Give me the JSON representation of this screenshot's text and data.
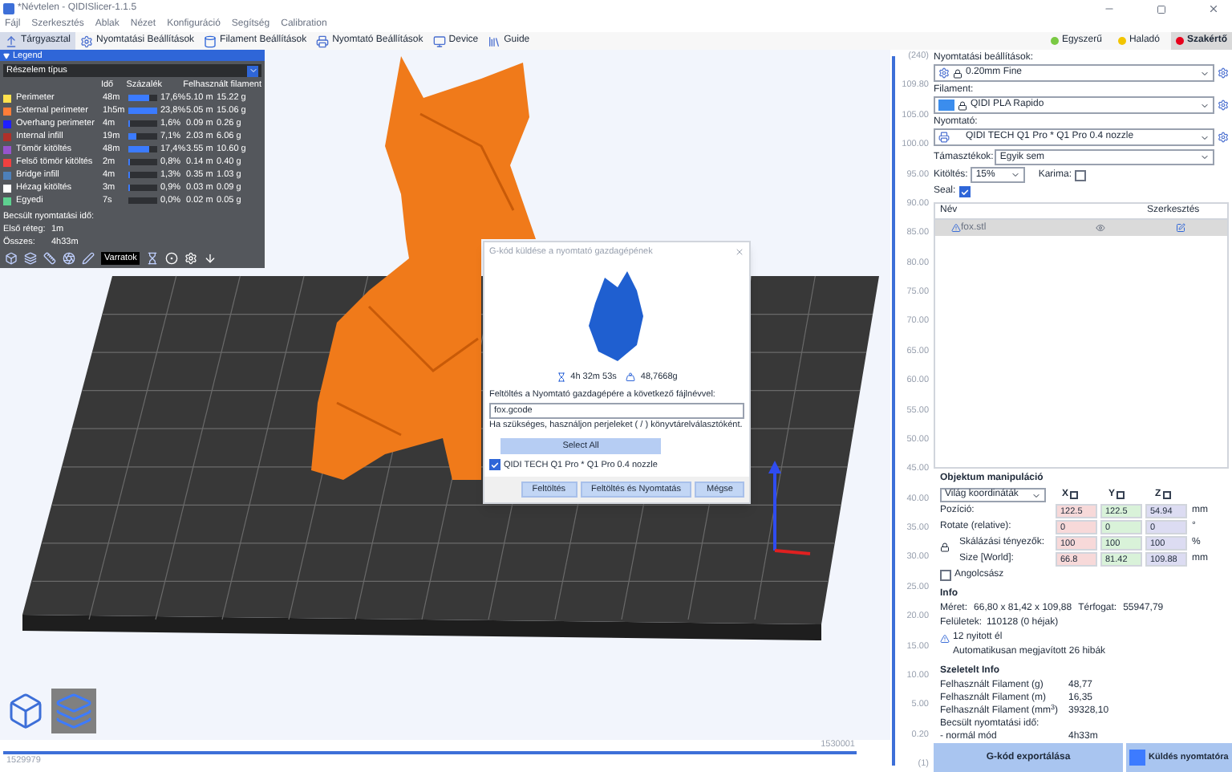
{
  "window": {
    "title": "*Névtelen - QIDISlicer-1.1.5"
  },
  "menu": [
    "Fájl",
    "Szerkesztés",
    "Ablak",
    "Nézet",
    "Konfiguráció",
    "Segítség",
    "Calibration"
  ],
  "tabs": [
    {
      "label": "Tárgyasztal",
      "kind": "plate",
      "selected": true
    },
    {
      "label": "Nyomtatási Beállítások",
      "kind": "print",
      "selected": false
    },
    {
      "label": "Filament Beállítások",
      "kind": "filament",
      "selected": false
    },
    {
      "label": "Nyomtató Beállítások",
      "kind": "printer",
      "selected": false
    },
    {
      "label": "Device",
      "kind": "device",
      "selected": false
    },
    {
      "label": "Guide",
      "kind": "guide",
      "selected": false
    }
  ],
  "modes": [
    {
      "label": "Egyszerű",
      "color": "#7ac943",
      "selected": false
    },
    {
      "label": "Haladó",
      "color": "#f2c500",
      "selected": false
    },
    {
      "label": "Szakértő",
      "color": "#e8001c",
      "selected": true
    }
  ],
  "legend": {
    "title": "Legend",
    "view_type": "Részelem típus",
    "columns": [
      "Idő",
      "Százalék",
      "Felhasznált filament"
    ],
    "rows": [
      {
        "name": "Perimeter",
        "color": "#ffe14d",
        "time": "48m",
        "level": 0.74,
        "percent": "17,6%",
        "length": "5.10 m",
        "weight": "15.22 g"
      },
      {
        "name": "External perimeter",
        "color": "#ff7d38",
        "time": "1h5m",
        "level": 1.0,
        "percent": "23,8%",
        "length": "5.05 m",
        "weight": "15.06 g"
      },
      {
        "name": "Overhang perimeter",
        "color": "#1f1fff",
        "time": "4m",
        "level": 0.07,
        "percent": "1,6%",
        "length": "0.09 m",
        "weight": "0.26 g"
      },
      {
        "name": "Internal infill",
        "color": "#b03029",
        "time": "19m",
        "level": 0.3,
        "percent": "7,1%",
        "length": "2.03 m",
        "weight": "6.06 g"
      },
      {
        "name": "Tömör kitöltés",
        "color": "#9654cc",
        "time": "48m",
        "level": 0.73,
        "percent": "17,4%",
        "length": "3.55 m",
        "weight": "10.60 g"
      },
      {
        "name": "Felső tömör kitöltés",
        "color": "#f04040",
        "time": "2m",
        "level": 0.03,
        "percent": "0,8%",
        "length": "0.14 m",
        "weight": "0.40 g"
      },
      {
        "name": "Bridge infill",
        "color": "#4d80ba",
        "time": "4m",
        "level": 0.05,
        "percent": "1,3%",
        "length": "0.35 m",
        "weight": "1.03 g"
      },
      {
        "name": "Hézag kitöltés",
        "color": "#ffffff",
        "time": "3m",
        "level": 0.04,
        "percent": "0,9%",
        "length": "0.03 m",
        "weight": "0.09 g"
      },
      {
        "name": "Egyedi",
        "color": "#5ed190",
        "time": "7s",
        "level": 0.0,
        "percent": "0,0%",
        "length": "0.02 m",
        "weight": "0.05 g"
      }
    ],
    "estimate_title": "Becsült nyomtatási idő:",
    "estimates": [
      {
        "label": "Első réteg:",
        "value": "1m"
      },
      {
        "label": "Összes:",
        "value": "4h33m"
      }
    ],
    "tooltip": "Varratok"
  },
  "dialog": {
    "title": "G-kód küldése a nyomtató gazdagépének",
    "time": "4h 32m 53s",
    "weight": "48,7668g",
    "prompt": "Feltöltés a Nyomtató gazdagépére a következő fájlnévvel:",
    "filename": "fox.gcode",
    "hint": "Ha szükséges, használjon perjeleket ( / ) könyvtárelválasztóként.",
    "select_all": "Select All",
    "printer": {
      "label": "QIDI TECH Q1 Pro * Q1 Pro 0.4 nozzle",
      "checked": true
    },
    "buttons": [
      "Feltöltés",
      "Feltöltés és Nyomtatás",
      "Mégse"
    ]
  },
  "view_buttons": [
    {
      "kind": "perspective",
      "selected": false
    },
    {
      "kind": "preview",
      "selected": true
    }
  ],
  "move_slider": {
    "level": 1.0,
    "left_value": "1529979",
    "right_value": "1530001"
  },
  "layer_slider": {
    "level": 1.0,
    "top_label": "(240)",
    "top_value": "109.80",
    "ticks": [
      "105.00",
      "100.00",
      "95.00",
      "90.00",
      "85.00",
      "80.00",
      "75.00",
      "70.00",
      "65.00",
      "60.00",
      "55.00",
      "50.00",
      "45.00",
      "40.00",
      "35.00",
      "30.00",
      "25.00",
      "20.00",
      "15.00",
      "10.00",
      "5.00"
    ],
    "bottom_value": "0.20",
    "bottom_label": "(1)"
  },
  "presets": [
    {
      "label": "Nyomtatási beállítások:",
      "kind": "print",
      "locked": true,
      "value": "0.20mm Fine"
    },
    {
      "label": "Filament:",
      "kind": "filament",
      "color": "#3b8ded",
      "locked": true,
      "value": "QIDI PLA Rapido"
    },
    {
      "label": "Nyomtató:",
      "kind": "printer",
      "locked": false,
      "value": "QIDI TECH Q1 Pro * Q1 Pro 0.4 nozzle"
    }
  ],
  "supports": {
    "label": "Támasztékok:",
    "value": "Egyik sem"
  },
  "infill": {
    "label": "Kitöltés:",
    "value": "15%"
  },
  "brim": {
    "label": "Karima:",
    "checked": false
  },
  "seal": {
    "label": "Seal:",
    "checked": true
  },
  "object_list": {
    "columns": [
      "Név",
      "Szerkesztés"
    ],
    "rows": [
      {
        "name": "fox.stl",
        "warning": true,
        "selected": true
      }
    ]
  },
  "manipulation": {
    "title": "Objektum manipuláció",
    "coordinates": "Világ koordináták",
    "axes": [
      "X",
      "Y",
      "Z"
    ],
    "rows": [
      {
        "label": "Pozíció:",
        "values": [
          "122.5",
          "122.5",
          "54.94"
        ],
        "unit": "mm"
      },
      {
        "label": "Rotate (relative):",
        "values": [
          "0",
          "0",
          "0"
        ],
        "unit": "°"
      },
      {
        "label": "Skálázási tényezők:",
        "values": [
          "100",
          "100",
          "100"
        ],
        "unit": "%"
      },
      {
        "label": "Size [World]:",
        "values": [
          "66.8",
          "81.42",
          "109.88"
        ],
        "unit": "mm"
      }
    ],
    "inches": {
      "label": "Angolcsász",
      "checked": false
    }
  },
  "info": {
    "title": "Info",
    "size_label": "Méret:",
    "size": "66,80 x 81,42 x 109,88",
    "volume_label": "Térfogat:",
    "volume": "55947,79",
    "facets_label": "Felületek:",
    "facets": "110128 (0 héjak)",
    "warning": "12 nyitott él",
    "repaired": "Automatikusan megjavított 26 hibák"
  },
  "sliced_info": {
    "title": "Szeletelt Info",
    "rows": [
      {
        "label": "Felhasznált Filament (g)",
        "value": "48,77"
      },
      {
        "label": "Felhasznált Filament (m)",
        "value": "16,35"
      },
      {
        "label": "Felhasznált Filament (mm$^{3}$)",
        "value": "39328,10"
      },
      {
        "label": "Becsült nyomtatási idő:",
        "value": ""
      },
      {
        "label": "- normál mód",
        "value": "4h33m"
      }
    ]
  },
  "actions": {
    "export": "G-kód exportálása",
    "send": "Küldés nyomtatóra"
  }
}
